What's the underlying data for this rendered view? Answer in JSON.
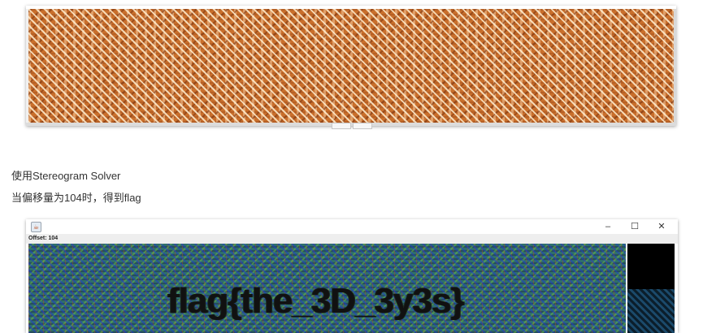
{
  "text": {
    "line1": "使用Stereogram Solver",
    "line2": "当偏移量为104时，得到flag"
  },
  "solver_window": {
    "offset_label": "Offset: 104",
    "controls": {
      "minimize": "–",
      "maximize": "☐",
      "close": "✕"
    },
    "java_icon": "java-icon",
    "result_text": "flag{the_3D_3y3s}"
  },
  "colors": {
    "stereogram": "#c96f2c",
    "solved_noise": "#2f6f6a"
  }
}
